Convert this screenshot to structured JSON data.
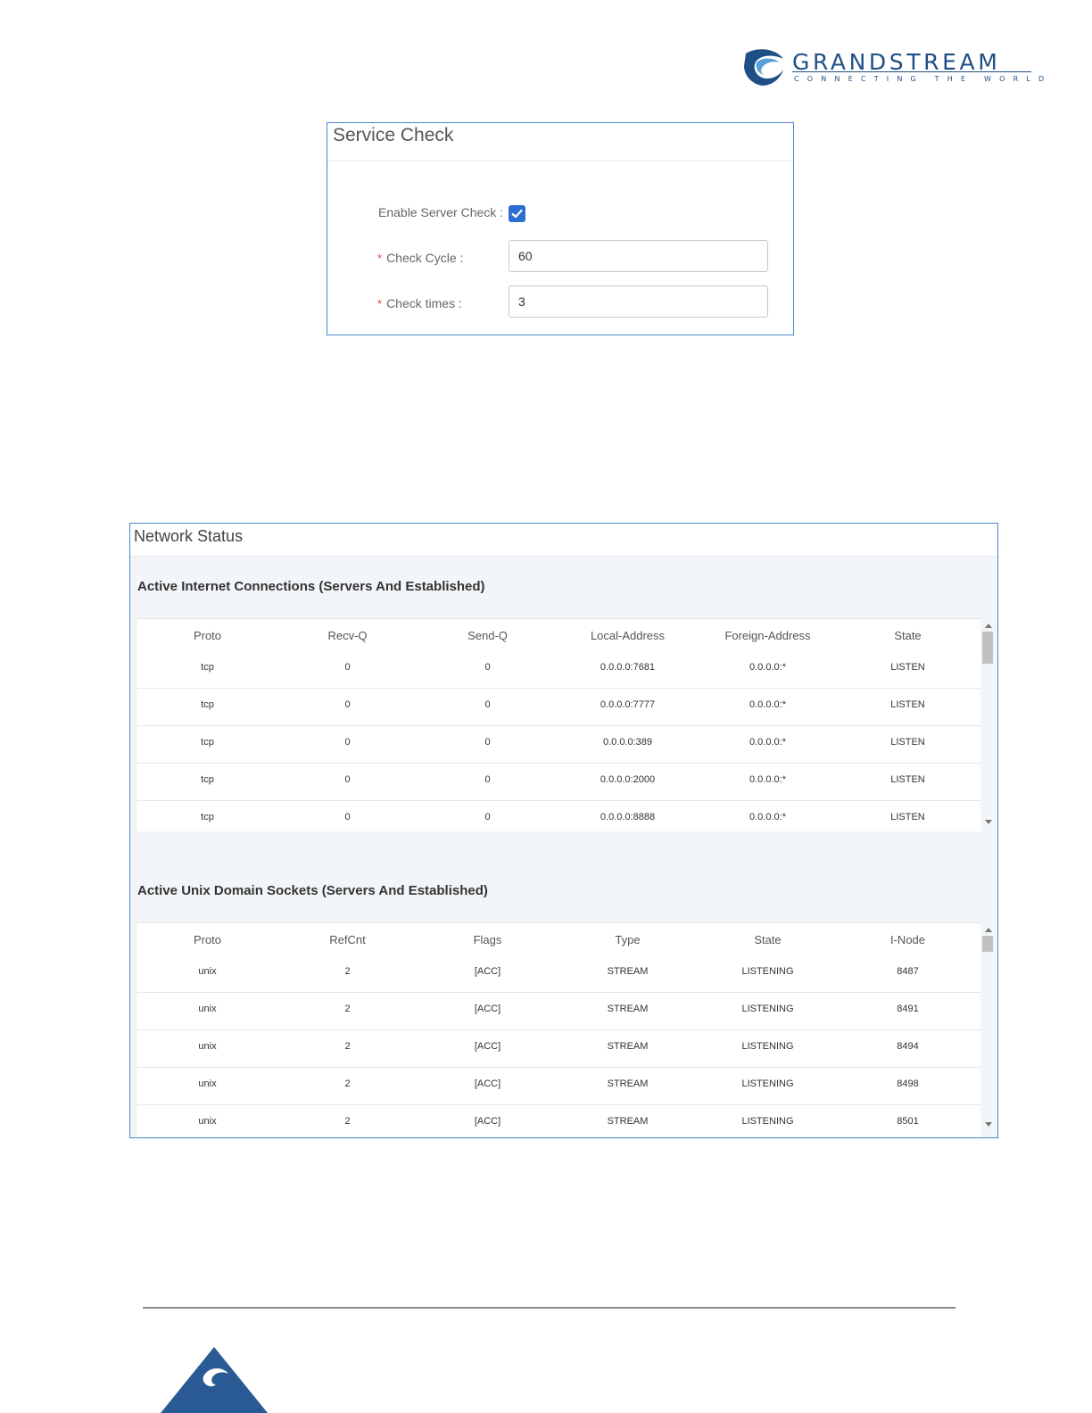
{
  "brand": {
    "name": "GRANDSTREAM",
    "tagline": "CONNECTING THE WORLD",
    "colors": {
      "primary": "#1f4f86",
      "accent": "#2d6fd1"
    },
    "logo_icon": "grandstream-logo-icon"
  },
  "service_check": {
    "title": "Service Check",
    "enable_label": "Enable Server Check :",
    "enable_checked": true,
    "required_mark": "*",
    "cycle_label": "Check Cycle :",
    "cycle_value": "60",
    "times_label": "Check times :",
    "times_value": "3"
  },
  "network_status": {
    "title": "Network Status",
    "internet": {
      "title": "Active Internet Connections (Servers And Established)",
      "columns": [
        "Proto",
        "Recv-Q",
        "Send-Q",
        "Local-Address",
        "Foreign-Address",
        "State"
      ],
      "rows": [
        [
          "tcp",
          "0",
          "0",
          "0.0.0.0:7681",
          "0.0.0.0:*",
          "LISTEN"
        ],
        [
          "tcp",
          "0",
          "0",
          "0.0.0.0:7777",
          "0.0.0.0:*",
          "LISTEN"
        ],
        [
          "tcp",
          "0",
          "0",
          "0.0.0.0:389",
          "0.0.0.0:*",
          "LISTEN"
        ],
        [
          "tcp",
          "0",
          "0",
          "0.0.0.0:2000",
          "0.0.0.0:*",
          "LISTEN"
        ],
        [
          "tcp",
          "0",
          "0",
          "0.0.0.0:8888",
          "0.0.0.0:*",
          "LISTEN"
        ]
      ]
    },
    "unix": {
      "title": "Active Unix Domain Sockets (Servers And Established)",
      "columns": [
        "Proto",
        "RefCnt",
        "Flags",
        "Type",
        "State",
        "I-Node"
      ],
      "rows": [
        [
          "unix",
          "2",
          "[ACC]",
          "STREAM",
          "LISTENING",
          "8487"
        ],
        [
          "unix",
          "2",
          "[ACC]",
          "STREAM",
          "LISTENING",
          "8491"
        ],
        [
          "unix",
          "2",
          "[ACC]",
          "STREAM",
          "LISTENING",
          "8494"
        ],
        [
          "unix",
          "2",
          "[ACC]",
          "STREAM",
          "LISTENING",
          "8498"
        ],
        [
          "unix",
          "2",
          "[ACC]",
          "STREAM",
          "LISTENING",
          "8501"
        ]
      ]
    }
  }
}
